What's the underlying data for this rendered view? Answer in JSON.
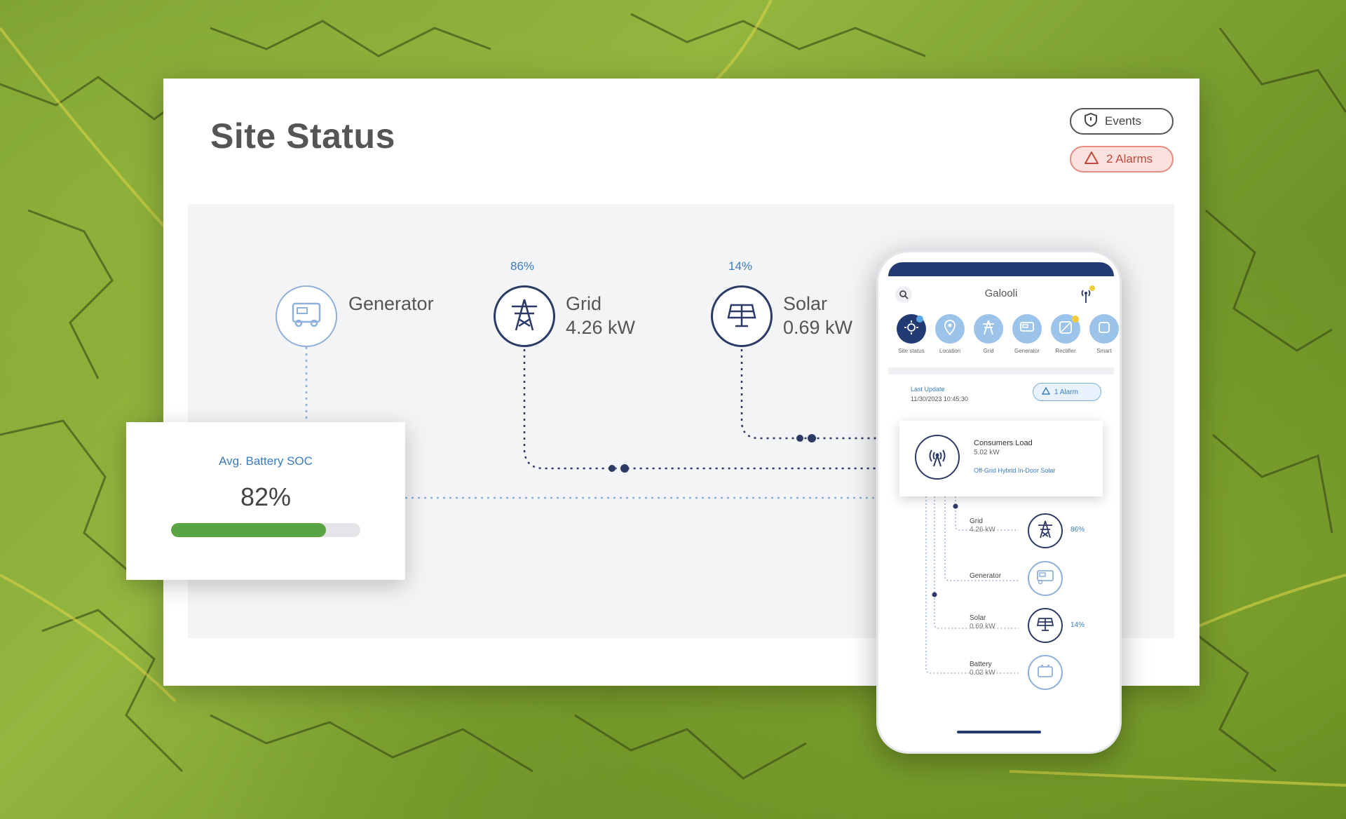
{
  "page": {
    "title": "Site Status"
  },
  "header": {
    "events_label": "Events",
    "alarms_label": "2 Alarms"
  },
  "nodes": {
    "generator": {
      "label": "Generator"
    },
    "grid": {
      "label": "Grid",
      "power": "4.26 kW",
      "percent": "86%"
    },
    "solar": {
      "label": "Solar",
      "power": "0.69 kW",
      "percent": "14%"
    }
  },
  "battery": {
    "label": "Avg. Battery SOC",
    "value": "82%",
    "fill_fraction": 0.82
  },
  "phone": {
    "title": "Galooli",
    "nav": [
      {
        "label": "Site status",
        "icon": "sun-icon"
      },
      {
        "label": "Location",
        "icon": "pin-icon"
      },
      {
        "label": "Grid",
        "icon": "tower-icon"
      },
      {
        "label": "Generator",
        "icon": "generator-icon"
      },
      {
        "label": "Rectifier",
        "icon": "rectifier-icon"
      },
      {
        "label": "Smart",
        "icon": "smart-icon"
      }
    ],
    "last_update_label": "Last Update",
    "last_update_value": "11/30/2023 10:45:30",
    "alarm_label": "1 Alarm",
    "consumer": {
      "title": "Consumers Load",
      "power": "5.02 kW",
      "mode": "Off-Grid Hybrid In-Door Solar"
    },
    "rows": [
      {
        "name": "Grid",
        "power": "4.26 kW",
        "percent": "86%"
      },
      {
        "name": "Generator",
        "power": "",
        "percent": ""
      },
      {
        "name": "Solar",
        "power": "0.69 kW",
        "percent": "14%"
      },
      {
        "name": "Battery",
        "power": "0.02 kW",
        "percent": ""
      }
    ]
  },
  "colors": {
    "accent": "#3a7cc0",
    "dark": "#2c3a66",
    "alarm": "#c0493e",
    "battery_fill": "#59a443"
  }
}
